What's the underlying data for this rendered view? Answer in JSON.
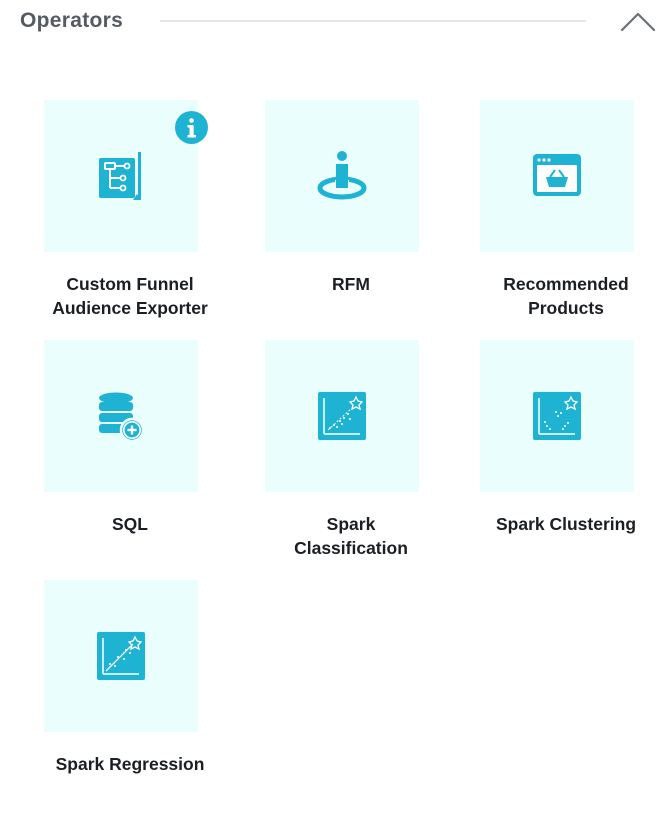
{
  "section": {
    "title": "Operators"
  },
  "operators": [
    {
      "label_lines": [
        "Custom Funnel",
        "Audience Exporter"
      ],
      "icon": "funnel-document-icon",
      "has_info": true
    },
    {
      "label_lines": [
        "RFM"
      ],
      "icon": "person-target-icon",
      "has_info": false
    },
    {
      "label_lines": [
        "Recommended",
        "Products"
      ],
      "icon": "shopping-basket-window-icon",
      "has_info": false
    },
    {
      "label_lines": [
        "SQL"
      ],
      "icon": "database-add-icon",
      "has_info": false
    },
    {
      "label_lines": [
        "Spark",
        "Classification"
      ],
      "icon": "scatter-chart-icon",
      "has_info": false
    },
    {
      "label_lines": [
        "Spark Clustering"
      ],
      "icon": "cluster-chart-icon",
      "has_info": false
    },
    {
      "label_lines": [
        "Spark Regression"
      ],
      "icon": "regression-chart-icon",
      "has_info": false
    }
  ],
  "colors": {
    "accent": "#1fb3d3",
    "tile_bg": "#eafefe",
    "title": "#555b61"
  }
}
